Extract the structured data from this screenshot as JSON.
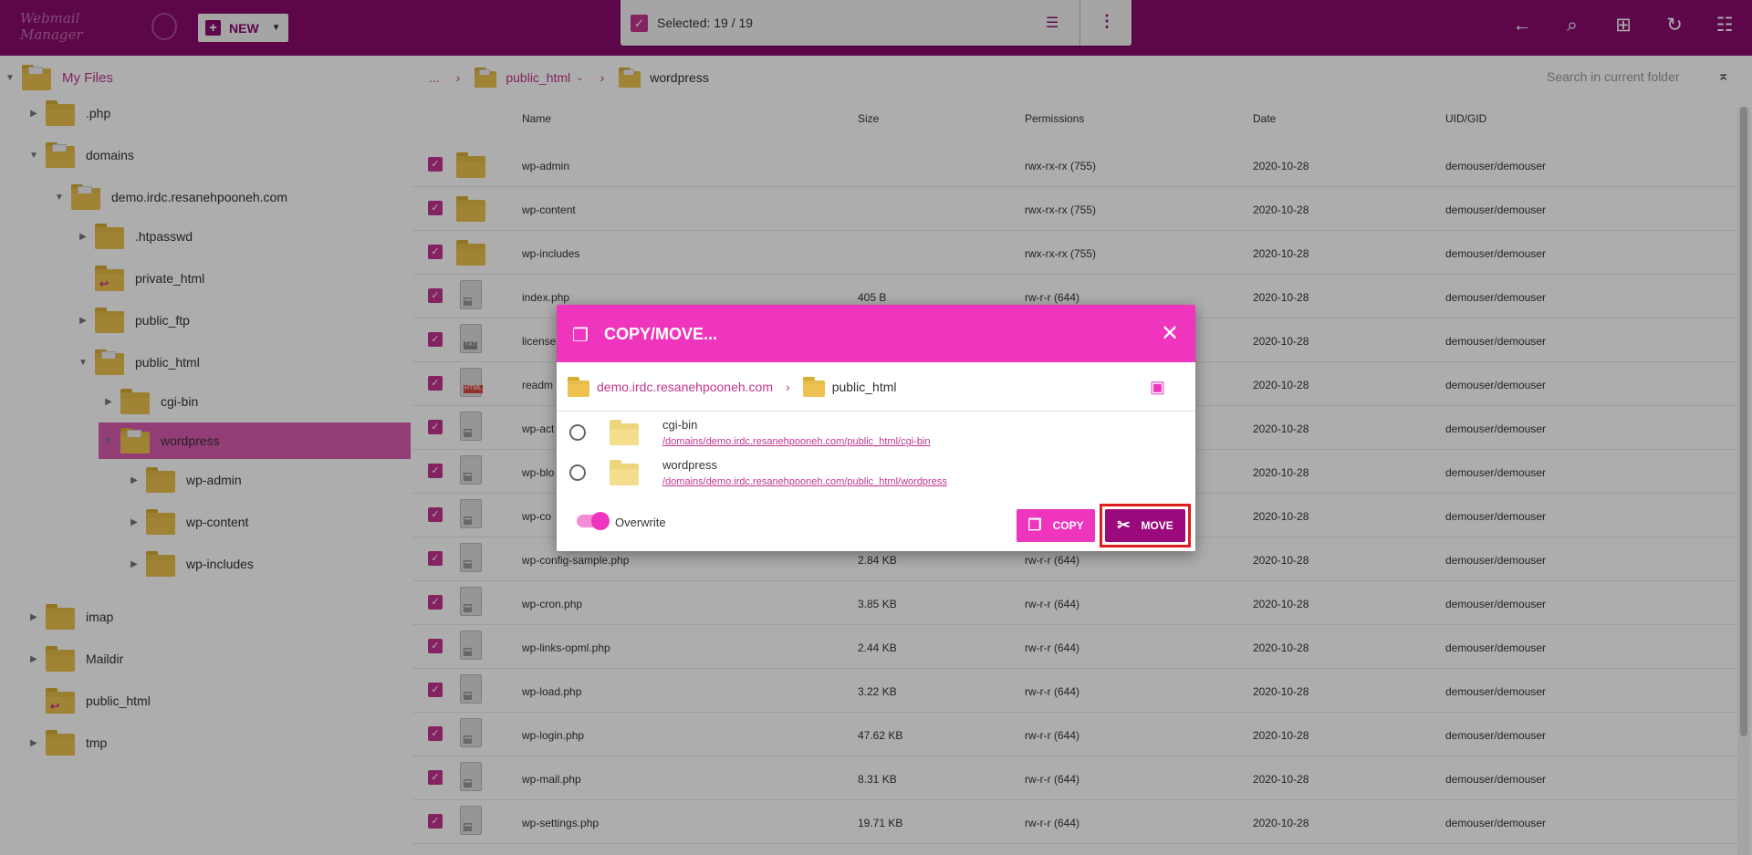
{
  "topbar": {
    "logo_text": "Webmail Manager",
    "new_label": "NEW",
    "selection_label": "Selected: 19 / 19",
    "icons": [
      "back-icon",
      "search-icon",
      "grid-icon",
      "refresh-icon",
      "settings-icon"
    ]
  },
  "sidebar": {
    "root": "My Files",
    "items": [
      {
        "label": ".php"
      },
      {
        "label": "domains"
      },
      {
        "label": "demo.irdc.resanehpooneh.com"
      },
      {
        "label": ".htpasswd"
      },
      {
        "label": "private_html"
      },
      {
        "label": "public_ftp"
      },
      {
        "label": "public_html"
      },
      {
        "label": "cgi-bin"
      },
      {
        "label": "wordpress"
      },
      {
        "label": "wp-admin"
      },
      {
        "label": "wp-content"
      },
      {
        "label": "wp-includes"
      },
      {
        "label": "imap"
      },
      {
        "label": "Maildir"
      },
      {
        "label": "public_html"
      },
      {
        "label": "tmp"
      }
    ]
  },
  "breadcrumb": {
    "dots": "...",
    "items": [
      "public_html",
      "wordpress"
    ],
    "search_placeholder": "Search in current folder"
  },
  "table": {
    "headers": [
      "Name",
      "Size",
      "Permissions",
      "Date",
      "UID/GID"
    ],
    "rows": [
      {
        "name": "wp-admin",
        "size": "",
        "perm": "rwx-rx-rx (755)",
        "date": "2020-10-28",
        "uid": "demouser/demouser"
      },
      {
        "name": "wp-content",
        "size": "",
        "perm": "rwx-rx-rx (755)",
        "date": "2020-10-28",
        "uid": "demouser/demouser"
      },
      {
        "name": "wp-includes",
        "size": "",
        "perm": "rwx-rx-rx (755)",
        "date": "2020-10-28",
        "uid": "demouser/demouser"
      },
      {
        "name": "index.php",
        "size": "405 B",
        "perm": "rw-r-r (644)",
        "date": "2020-10-28",
        "uid": "demouser/demouser"
      },
      {
        "name": "license",
        "size": "",
        "perm": "",
        "date": "2020-10-28",
        "uid": "demouser/demouser"
      },
      {
        "name": "readm",
        "size": "",
        "perm": "",
        "date": "2020-10-28",
        "uid": "demouser/demouser"
      },
      {
        "name": "wp-act",
        "size": "",
        "perm": "",
        "date": "2020-10-28",
        "uid": "demouser/demouser"
      },
      {
        "name": "wp-blo",
        "size": "",
        "perm": "",
        "date": "2020-10-28",
        "uid": "demouser/demouser"
      },
      {
        "name": "wp-co",
        "size": "",
        "perm": "",
        "date": "2020-10-28",
        "uid": "demouser/demouser"
      },
      {
        "name": "wp-config-sample.php",
        "size": "2.84 KB",
        "perm": "rw-r-r (644)",
        "date": "2020-10-28",
        "uid": "demouser/demouser"
      },
      {
        "name": "wp-cron.php",
        "size": "3.85 KB",
        "perm": "rw-r-r (644)",
        "date": "2020-10-28",
        "uid": "demouser/demouser"
      },
      {
        "name": "wp-links-opml.php",
        "size": "2.44 KB",
        "perm": "rw-r-r (644)",
        "date": "2020-10-28",
        "uid": "demouser/demouser"
      },
      {
        "name": "wp-load.php",
        "size": "3.22 KB",
        "perm": "rw-r-r (644)",
        "date": "2020-10-28",
        "uid": "demouser/demouser"
      },
      {
        "name": "wp-login.php",
        "size": "47.62 KB",
        "perm": "rw-r-r (644)",
        "date": "2020-10-28",
        "uid": "demouser/demouser"
      },
      {
        "name": "wp-mail.php",
        "size": "8.31 KB",
        "perm": "rw-r-r (644)",
        "date": "2020-10-28",
        "uid": "demouser/demouser"
      },
      {
        "name": "wp-settings.php",
        "size": "19.71 KB",
        "perm": "rw-r-r (644)",
        "date": "2020-10-28",
        "uid": "demouser/demouser"
      }
    ]
  },
  "modal": {
    "title": "COPY/MOVE...",
    "breadcrumb": [
      "demo.irdc.resanehpooneh.com",
      "public_html"
    ],
    "items": [
      {
        "name": "cgi-bin",
        "path": "/domains/demo.irdc.resanehpooneh.com/public_html/cgi-bin"
      },
      {
        "name": "wordpress",
        "path": "/domains/demo.irdc.resanehpooneh.com/public_html/wordpress"
      }
    ],
    "overwrite_label": "Overwrite",
    "copy_label": "COPY",
    "move_label": "MOVE"
  },
  "colors": {
    "brand": "#8a0a6e",
    "accent": "#ef35bd",
    "highlight": "#e01b1b"
  }
}
